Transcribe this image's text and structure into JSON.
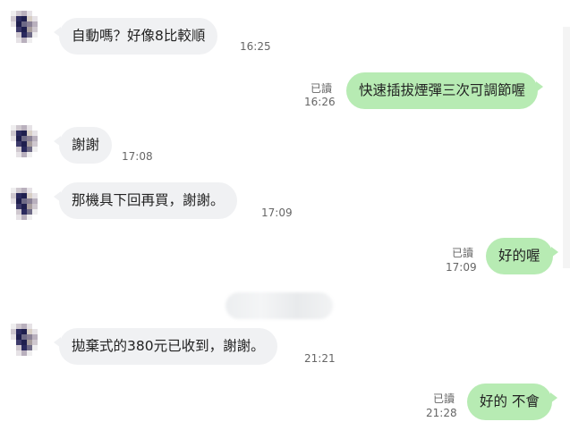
{
  "messages": [
    {
      "side": "in",
      "text": "自動嗎？好像8比較順",
      "time": "16:25"
    },
    {
      "side": "out",
      "text": "快速插拔煙彈三次可調節喔",
      "read": "已讀",
      "time": "16:26"
    },
    {
      "side": "in",
      "text": "謝謝",
      "time": "17:08"
    },
    {
      "side": "in",
      "text": "那機具下回再買，謝謝。",
      "time": "17:09"
    },
    {
      "side": "out",
      "text": "好的喔",
      "read": "已讀",
      "time": "17:09"
    },
    {
      "side": "in",
      "text": "拋棄式的380元已收到，謝謝。",
      "time": "21:21"
    },
    {
      "side": "out",
      "text": "好的 不會",
      "read": "已讀",
      "time": "21:28"
    }
  ],
  "colors": {
    "incoming_bubble": "#f0f1f3",
    "outgoing_bubble": "#b7ebb3",
    "meta_text": "#666666"
  }
}
